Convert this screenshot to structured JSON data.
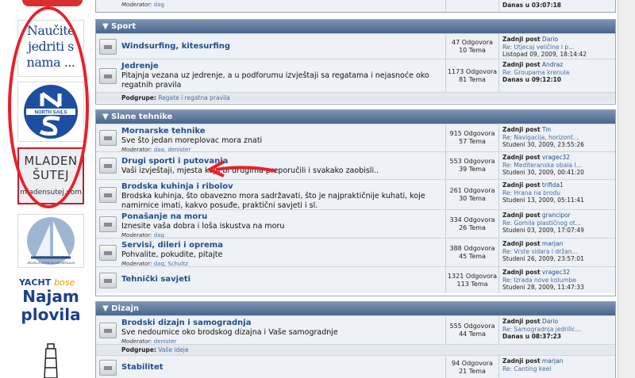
{
  "ads": {
    "jedriti": "Naučite jedriti s nama ...",
    "north_sails": "NORTH SAILS",
    "mladen_name": "MLADEN ŠUTEJ",
    "mladen_url": "mladensutej.com",
    "klub": "JEDRILIČARSKI KLUB MEDULIN",
    "yacht_brand": "YACHT",
    "yacht_bose": "bose",
    "yacht_l1": "Najam",
    "yacht_l2": "plovila"
  },
  "top_row": {
    "moderator_label": "Moderator:",
    "moderator": "dag",
    "last": "Danas u 03:07:18"
  },
  "sections": [
    {
      "title": "Sport",
      "rows": [
        {
          "title": "Windsurfing, kitesurfing",
          "desc": "",
          "mod": "",
          "posts": "47 Odgovora",
          "topics": "10 Tema",
          "last_label": "Zadnji post",
          "last_user": "Dario",
          "last_topic": "Re: Utjecaj veličine i p...",
          "last_date": "Listopad 09, 2009, 18:14:42"
        },
        {
          "title": "Jedrenje",
          "desc": "Pitajnja vezana uz jedrenje, a u podforumu izvještaji sa regatama i nejasnoće oko regatnih pravila",
          "mod": "",
          "posts": "1173 Odgovora",
          "topics": "81 Tema",
          "last_label": "Zadnji post",
          "last_user": "Andraz",
          "last_topic": "Re: Groupama krenula",
          "last_date": "Danas u 09:12:10"
        }
      ],
      "podgrupe_label": "Podgrupe:",
      "podgrupe": "Regate i regatna pravila"
    },
    {
      "title": "Slane tehnike",
      "rows": [
        {
          "title": "Mornarske tehnike",
          "desc": "Sve što jedan moreplovac mora znati",
          "mod": "dag, denister",
          "posts": "915 Odgovora",
          "topics": "57 Tema",
          "last_label": "Zadnji post",
          "last_user": "Tin",
          "last_topic": "Re: Navigacija, horizont...",
          "last_date": "Studeni 30, 2009, 23:55:26"
        },
        {
          "title": "Drugi sporti i putovanja",
          "desc": "Vaši izvještaji, mjesta koja bi drugima preporučili i svakako zaobisli..",
          "mod": "",
          "posts": "553 Odgovora",
          "topics": "39 Tema",
          "last_label": "Zadnji post",
          "last_user": "vragec32",
          "last_topic": "Re: Mediteranska obala I...",
          "last_date": "Studeni 30, 2009, 00:41:20"
        },
        {
          "title": "Brodska kuhinja i ribolov",
          "desc": "Brodska kuhinja, što obavezno mora sadržavati, što je najpraktičnije kuhati, koje namirnice imati, kakvo posuđe, praktični savjeti i sl.",
          "mod": "",
          "posts": "261 Odgovora",
          "topics": "30 Tema",
          "last_label": "Zadnji post",
          "last_user": "trifida1",
          "last_topic": "Re: Hrana na brodu",
          "last_date": "Studeni 13, 2009, 05:11:41"
        },
        {
          "title": "Ponašanje na moru",
          "desc": "Iznesite vaša dobra i loša iskustva na moru",
          "mod": "dag",
          "posts": "334 Odgovora",
          "topics": "26 Tema",
          "last_label": "Zadnji post",
          "last_user": "grancipor",
          "last_topic": "Re: Gomila plastičnog ot...",
          "last_date": "Studeni 03, 2009, 17:07:49"
        },
        {
          "title": "Servisi, dileri i oprema",
          "desc": "Pohvalite, pokudite, pitajte",
          "mod": "dag, Schultz",
          "posts": "388 Odgovora",
          "topics": "45 Tema",
          "last_label": "Zadnji post",
          "last_user": "marjan",
          "last_topic": "Re: Vrste sidara i držan...",
          "last_date": "Studeni 26, 2009, 23:57:01"
        },
        {
          "title": "Tehnički savjeti",
          "desc": "",
          "mod": "",
          "posts": "1321 Odgovora",
          "topics": "113 Tema",
          "last_label": "Zadnji post",
          "last_user": "vragec32",
          "last_topic": "Re: Izrada nove kolumbe",
          "last_date": "Studeni 28, 2009, 11:47:33"
        }
      ]
    },
    {
      "title": "Dizajn",
      "rows": [
        {
          "title": "Brodski dizajn i samogradnja",
          "desc": "Sve nedoumice oko brodskog dizajna i Vaše samogradnje",
          "mod": "denister",
          "posts": "555 Odgovora",
          "topics": "44 Tema",
          "last_label": "Zadnji post",
          "last_user": "Dario",
          "last_topic": "Re: Samogradnja jedrilic...",
          "last_date": "Danas u 08:37:23"
        },
        {
          "title": "Stabilitet",
          "desc": "",
          "mod": "",
          "posts": "94 Odgovora",
          "topics": "21 Tema",
          "last_label": "Zadnji post",
          "last_user": "marjan",
          "last_topic": "Re: Canting keel",
          "last_date": ""
        }
      ],
      "podgrupe_label": "Podgrupe:",
      "podgrupe": "Vaše ideje"
    }
  ],
  "mod_label": "Moderator:"
}
